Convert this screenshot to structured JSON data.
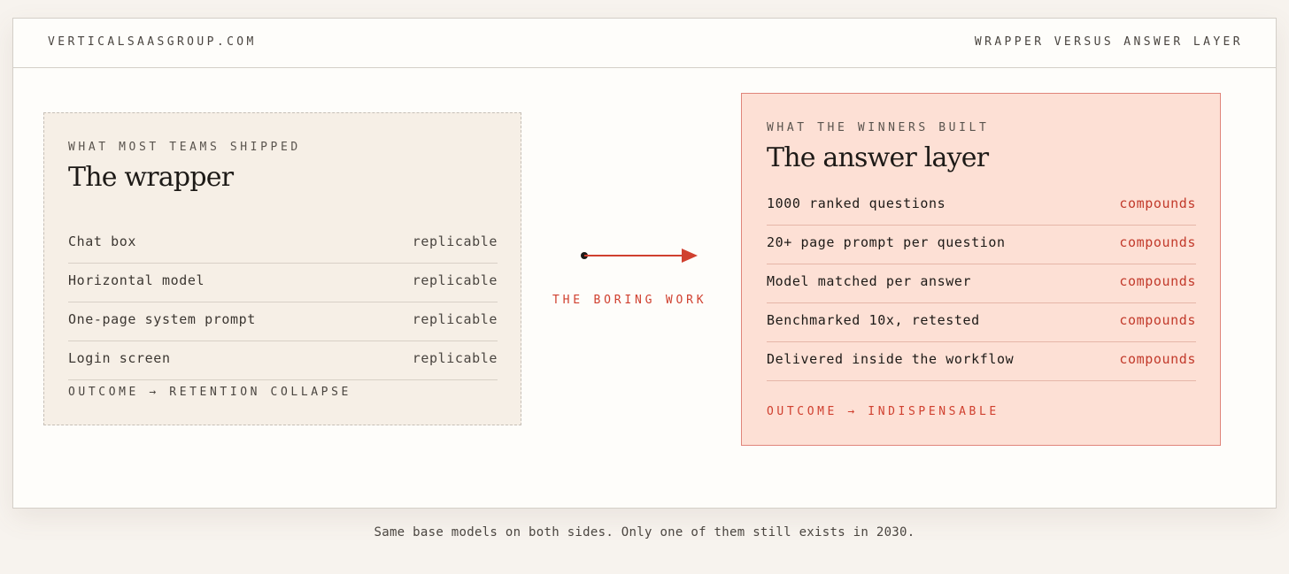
{
  "header": {
    "brand": "VERTICALSAASGROUP.COM",
    "title": "WRAPPER VERSUS ANSWER LAYER"
  },
  "left_panel": {
    "kicker": "WHAT MOST TEAMS SHIPPED",
    "title": "The wrapper",
    "rows": [
      {
        "label": "Chat box",
        "value": "replicable"
      },
      {
        "label": "Horizontal model",
        "value": "replicable"
      },
      {
        "label": "One-page system prompt",
        "value": "replicable"
      },
      {
        "label": "Login screen",
        "value": "replicable"
      }
    ],
    "outcome": "OUTCOME → RETENTION COLLAPSE"
  },
  "connector": {
    "label": "THE BORING WORK"
  },
  "right_panel": {
    "kicker": "WHAT THE WINNERS BUILT",
    "title": "The answer layer",
    "rows": [
      {
        "label": "1000 ranked questions",
        "value": "compounds"
      },
      {
        "label": "20+ page prompt per question",
        "value": "compounds"
      },
      {
        "label": "Model matched per answer",
        "value": "compounds"
      },
      {
        "label": "Benchmarked 10x, retested",
        "value": "compounds"
      },
      {
        "label": "Delivered inside the workflow",
        "value": "compounds"
      }
    ],
    "outcome": "OUTCOME → INDISPENSABLE"
  },
  "caption": "Same base models on both sides. Only one of them still exists in 2030.",
  "colors": {
    "accent": "#d0402f",
    "right_panel_fill": "#fde0d5",
    "left_panel_fill": "#f6efe6"
  }
}
